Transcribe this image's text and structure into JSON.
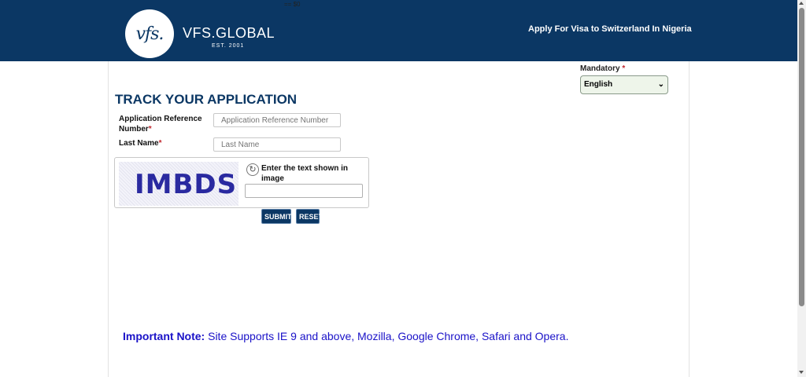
{
  "header": {
    "logo_script": "vfs.",
    "logo_name": "VFS.GLOBAL",
    "logo_est": "EST. 2001",
    "top_marker": "== $0",
    "title": "Apply For Visa to Switzerland  In Nigeria"
  },
  "language": {
    "mandatory_label": "Mandatory",
    "required_mark": "*",
    "selected": "English"
  },
  "form": {
    "title": "TRACK YOUR APPLICATION",
    "ref_label": "Application Reference Number",
    "ref_placeholder": "Application Reference Number",
    "last_label": "Last Name",
    "last_placeholder": "Last Name",
    "required_mark": "*",
    "captcha_text": "IMBDS",
    "captcha_label": "Enter the text shown in image",
    "submit_label": "SUBMIT",
    "reset_label": "RESET"
  },
  "note": {
    "bold": "Important Note:",
    "text": " Site Supports IE 9 and above, Mozilla, Google Chrome, Safari and Opera."
  },
  "colors": {
    "brand_navy": "#0b3764",
    "required_red": "#c0262d",
    "note_blue": "#1a12c8"
  },
  "icons": [
    "refresh-icon",
    "chevron-down-icon"
  ]
}
